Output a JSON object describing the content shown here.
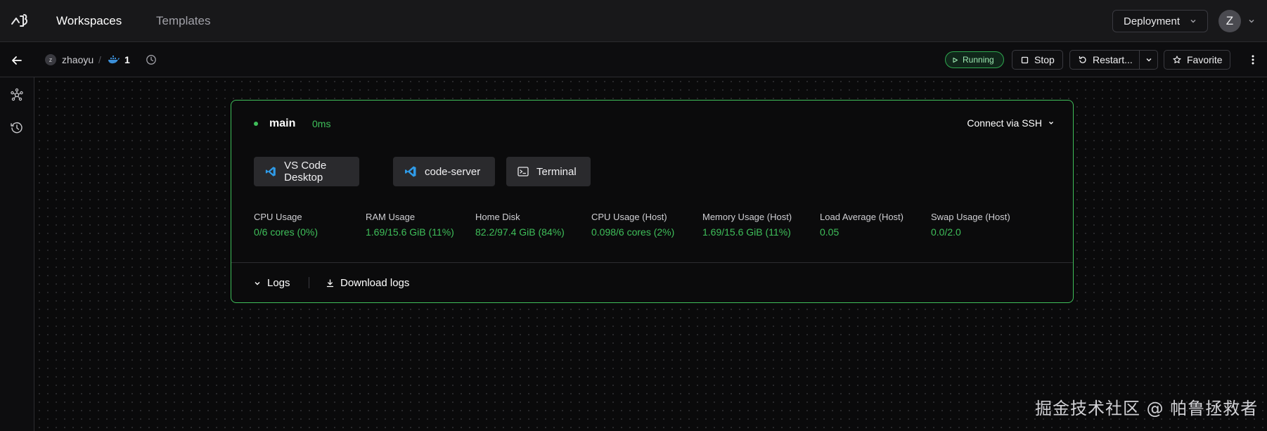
{
  "nav": {
    "workspaces": "Workspaces",
    "templates": "Templates",
    "deployment": "Deployment",
    "user_initial": "Z"
  },
  "workspace": {
    "owner_initial": "z",
    "owner": "zhaoyu",
    "separator": "/",
    "name": "1",
    "status": "Running",
    "actions": {
      "stop": "Stop",
      "restart": "Restart...",
      "favorite": "Favorite"
    }
  },
  "agent": {
    "name": "main",
    "latency": "0ms",
    "connect_ssh": "Connect via SSH",
    "apps": [
      {
        "label": "VS Code Desktop",
        "icon": "vscode-icon"
      },
      {
        "label": "code-server",
        "icon": "vscode-icon"
      },
      {
        "label": "Terminal",
        "icon": "terminal-icon"
      }
    ],
    "stats": [
      {
        "label": "CPU Usage",
        "value": "0/6 cores (0%)"
      },
      {
        "label": "RAM Usage",
        "value": "1.69/15.6 GiB (11%)"
      },
      {
        "label": "Home Disk",
        "value": "82.2/97.4 GiB (84%)"
      },
      {
        "label": "CPU Usage (Host)",
        "value": "0.098/6 cores (2%)"
      },
      {
        "label": "Memory Usage (Host)",
        "value": "1.69/15.6 GiB (11%)"
      },
      {
        "label": "Load Average (Host)",
        "value": "0.05"
      },
      {
        "label": "Swap Usage (Host)",
        "value": "0.0/2.0"
      }
    ],
    "logs": "Logs",
    "download_logs": "Download logs"
  },
  "colors": {
    "accent_green": "#3fbf5a",
    "background": "#0a0a0b",
    "topbar": "#18181a"
  },
  "watermark": "掘金技术社区 @ 帕鲁拯救者"
}
